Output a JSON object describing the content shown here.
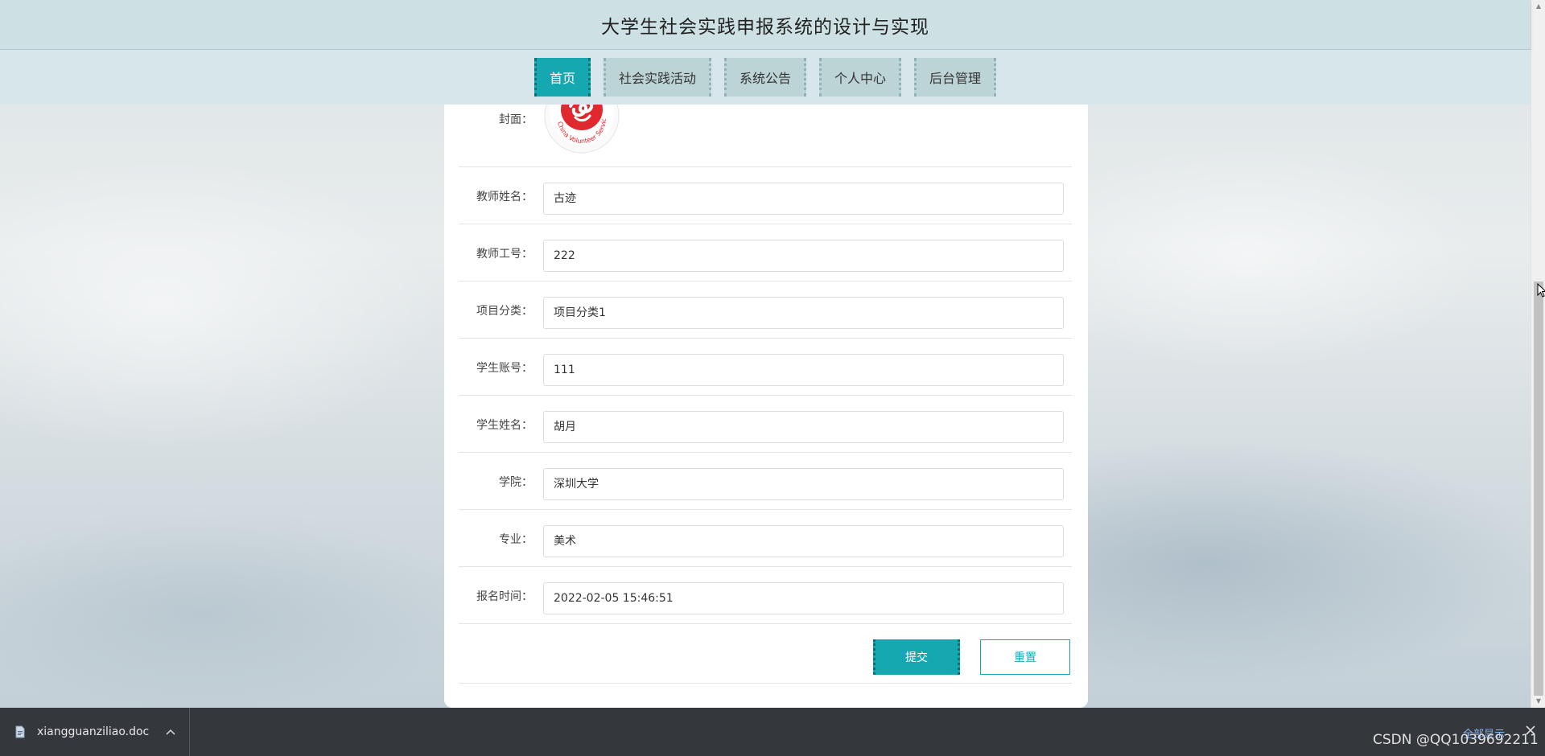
{
  "header": {
    "title": "大学生社会实践申报系统的设计与实现"
  },
  "nav": {
    "items": [
      {
        "label": "首页",
        "active": true
      },
      {
        "label": "社会实践活动",
        "active": false
      },
      {
        "label": "系统公告",
        "active": false
      },
      {
        "label": "个人中心",
        "active": false
      },
      {
        "label": "后台管理",
        "active": false
      }
    ]
  },
  "form": {
    "cover_label": "封面：",
    "cover_logo_text": "China Volunteer Service",
    "fields": [
      {
        "label": "教师姓名：",
        "value": "古迹"
      },
      {
        "label": "教师工号：",
        "value": "222"
      },
      {
        "label": "项目分类：",
        "value": "项目分类1"
      },
      {
        "label": "学生账号：",
        "value": "111"
      },
      {
        "label": "学生姓名：",
        "value": "胡月"
      },
      {
        "label": "学院：",
        "value": "深圳大学"
      },
      {
        "label": "专业：",
        "value": "美术"
      },
      {
        "label": "报名时间：",
        "value": "2022-02-05 15:46:51"
      }
    ],
    "submit_label": "提交",
    "reset_label": "重置"
  },
  "download_bar": {
    "filename": "xiangguanziliao.doc",
    "show_all_label": "全部显示",
    "file_icon": "document-icon",
    "chevron_icon": "chevron-up-icon",
    "close_icon": "close-icon"
  },
  "watermark": "CSDN @QQ1039692211",
  "colors": {
    "accent": "#16a8b0",
    "header_bg": "#cde0e3",
    "download_bar_bg": "#34373b"
  }
}
